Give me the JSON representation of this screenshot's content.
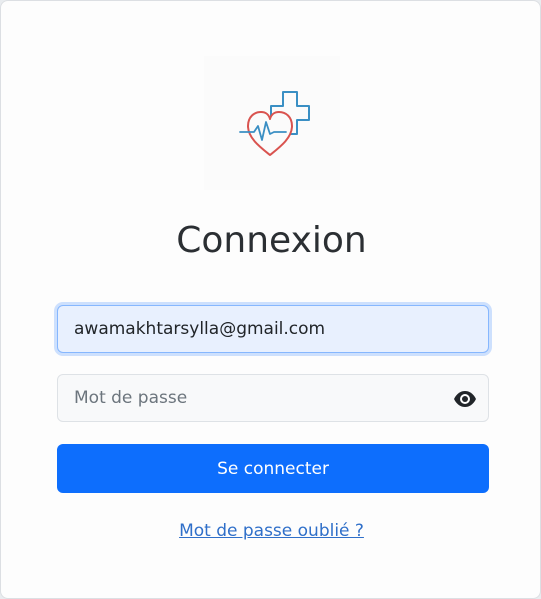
{
  "login": {
    "title": "Connexion",
    "email_value": "awamakhtarsylla@gmail.com",
    "password_placeholder": "Mot de passe",
    "submit_label": "Se connecter",
    "forgot_link": "Mot de passe oublié ?"
  },
  "icons": {
    "logo": "heart-medical-cross-icon",
    "toggle_password": "eye-icon"
  },
  "colors": {
    "primary": "#0d6efd",
    "logo_cross": "#3a8fc4",
    "logo_heart": "#d9534f",
    "email_field_bg": "#e8f0fe"
  }
}
